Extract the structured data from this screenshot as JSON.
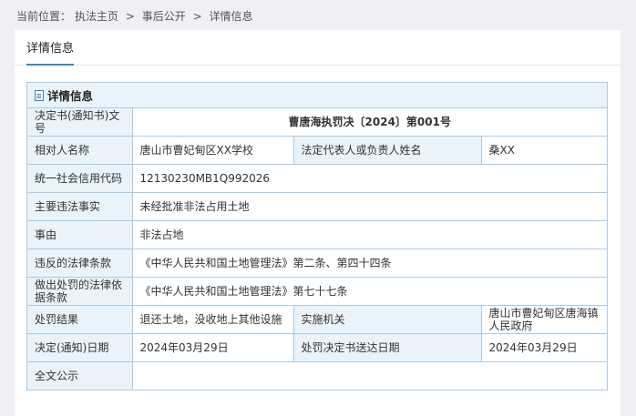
{
  "breadcrumb": {
    "prefix": "当前位置：",
    "items": [
      "执法主页",
      "事后公开",
      "详情信息"
    ],
    "separator": ">"
  },
  "tab": {
    "label": "详情信息"
  },
  "detail": {
    "header": "详情信息",
    "rows": {
      "decision_no": {
        "label": "决定书(通知书)文号",
        "value": "曹唐海执罚决〔2024〕第001号"
      },
      "party": {
        "label": "相对人名称",
        "value": "唐山市曹妃甸区XX学校",
        "label2": "法定代表人或负责人姓名",
        "value2": "桑XX"
      },
      "credit_code": {
        "label": "统一社会信用代码",
        "value": "12130230MB1Q992026"
      },
      "violation": {
        "label": "主要违法事实",
        "value": "未经批准非法占用土地"
      },
      "cause": {
        "label": "事由",
        "value": "非法占地"
      },
      "violated_law": {
        "label": "违反的法律条款",
        "value": "《中华人民共和国土地管理法》第二条、第四十四条"
      },
      "penalty_basis": {
        "label": "做出处罚的法律依据条款",
        "value": "《中华人民共和国土地管理法》第七十七条"
      },
      "result": {
        "label": "处罚结果",
        "value": "退还土地，没收地上其他设施",
        "label2": "实施机关",
        "value2": "唐山市曹妃甸区唐海镇人民政府"
      },
      "dates": {
        "label": "决定(通知)日期",
        "value": "2024年03月29日",
        "label2": "处罚决定书送达日期",
        "value2": "2024年03月29日"
      },
      "fulltext": {
        "label": "全文公示",
        "value": ""
      }
    }
  }
}
